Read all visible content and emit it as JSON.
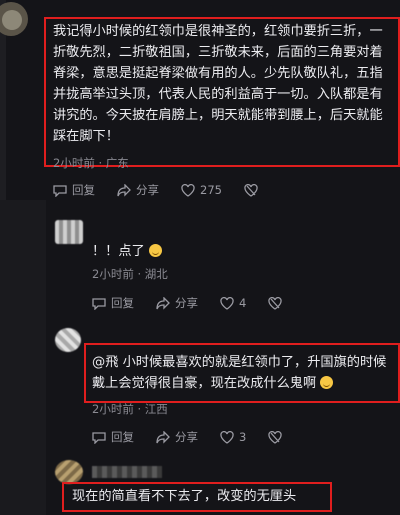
{
  "comments": [
    {
      "text": "我记得小时候的红领巾是很神圣的，红领巾要折三折，一折敬先烈，二折敬祖国，三折敬未来，后面的三角要对着脊梁，意思是挺起脊梁做有用的人。少先队敬队礼，五指并拢高举过头顶，代表人民的利益高于一切。入队都是有讲究的。今天披在肩膀上，明天就能带到腰上，后天就能踩在脚下！",
      "time": "2小时前 · 广东",
      "reply_label": "回复",
      "share_label": "分享",
      "likes": "275"
    },
    {
      "text": "！！点了",
      "emoji": "grin-emoji",
      "time": "2小时前 · 湖北",
      "reply_label": "回复",
      "share_label": "分享",
      "likes": "4"
    },
    {
      "text": "@飛  小时候最喜欢的就是红领巾了，升国旗的时候戴上会觉得很自豪，现在改成什么鬼啊",
      "emoji": "laugh-cry-emoji",
      "time": "2小时前 · 江西",
      "reply_label": "回复",
      "share_label": "分享",
      "likes": "3"
    },
    {
      "text": "现在的简直看不下去了，改变的无厘头"
    }
  ],
  "colors": {
    "highlight": "#e01e1e",
    "background": "#141418"
  }
}
